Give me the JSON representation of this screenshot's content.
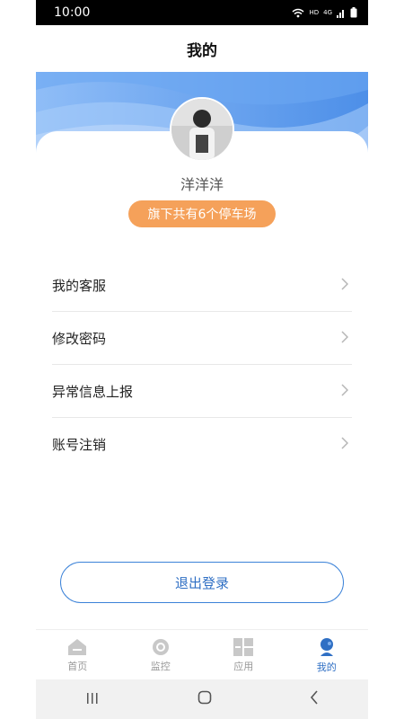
{
  "status_bar": {
    "time": "10:00",
    "icons": [
      "wifi-icon",
      "hd-icon",
      "4g-signal-icon",
      "battery-icon"
    ],
    "hd_label": "HD",
    "net_label": "4G"
  },
  "nav": {
    "title": "我的"
  },
  "profile": {
    "username": "洋洋洋",
    "lots_badge": "旗下共有6个停车场",
    "badge_color": "#f5a15a"
  },
  "menu": {
    "items": [
      {
        "label": "我的客服",
        "icon": "chevron-right-icon"
      },
      {
        "label": "修改密码",
        "icon": "chevron-right-icon"
      },
      {
        "label": "异常信息上报",
        "icon": "chevron-right-icon"
      },
      {
        "label": "账号注销",
        "icon": "chevron-right-icon"
      }
    ]
  },
  "logout": {
    "label": "退出登录"
  },
  "tabs": [
    {
      "label": "首页",
      "icon": "home-icon",
      "active": false
    },
    {
      "label": "监控",
      "icon": "camera-icon",
      "active": false
    },
    {
      "label": "应用",
      "icon": "apps-grid-icon",
      "active": false
    },
    {
      "label": "我的",
      "icon": "user-icon",
      "active": true
    }
  ],
  "colors": {
    "accent": "#2f6fc4",
    "header_blue": "#5b9cf0",
    "inactive": "#999999"
  }
}
